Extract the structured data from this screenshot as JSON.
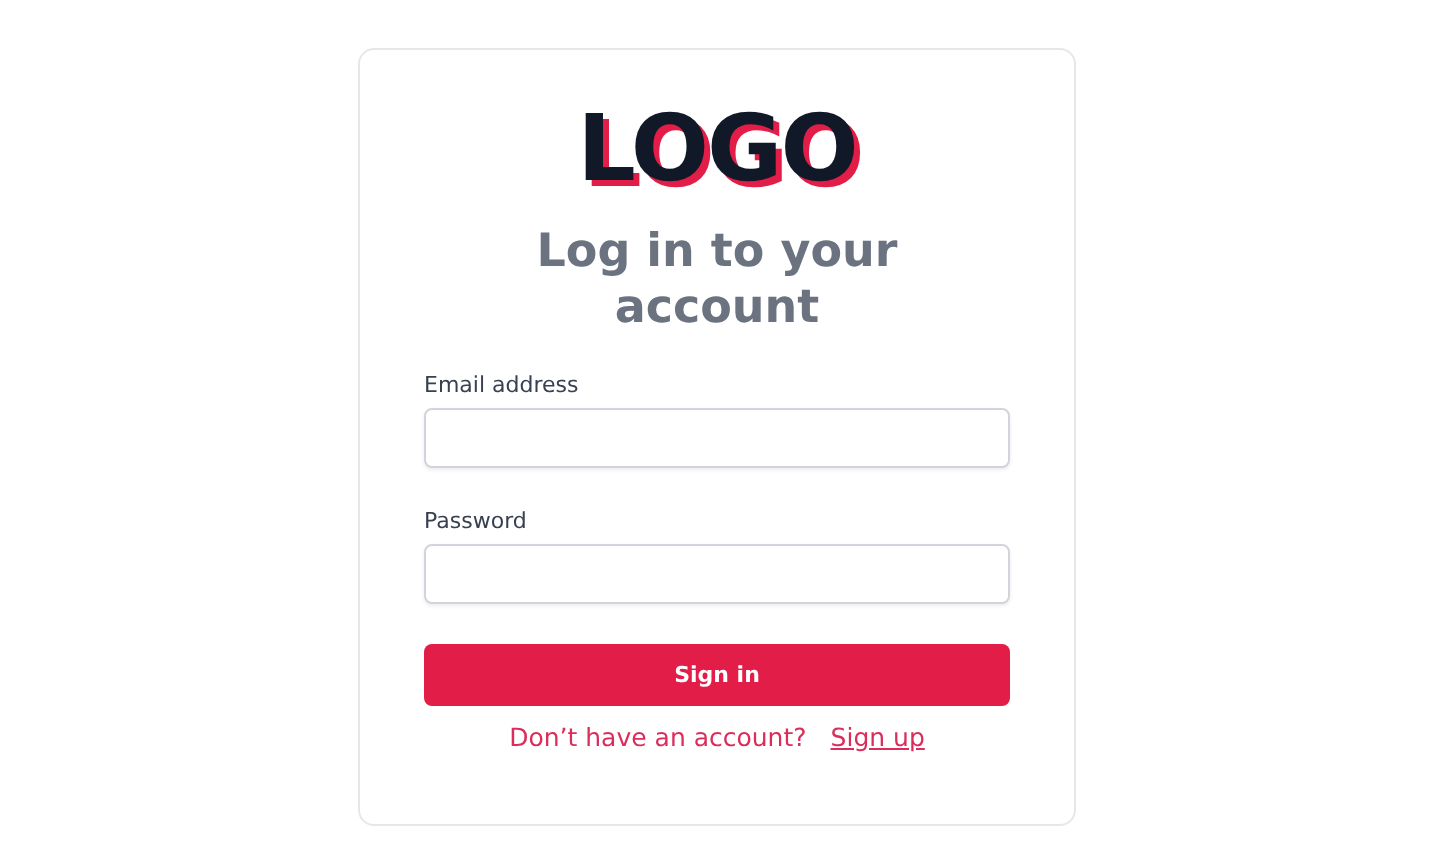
{
  "logo": "LOGO",
  "title": "Log in to your account",
  "fields": [
    {
      "label": "Email address"
    },
    {
      "label": "Password"
    }
  ],
  "submit": "Sign in",
  "footer": {
    "prompt": "Don’t have an account?",
    "link": "Sign up"
  }
}
